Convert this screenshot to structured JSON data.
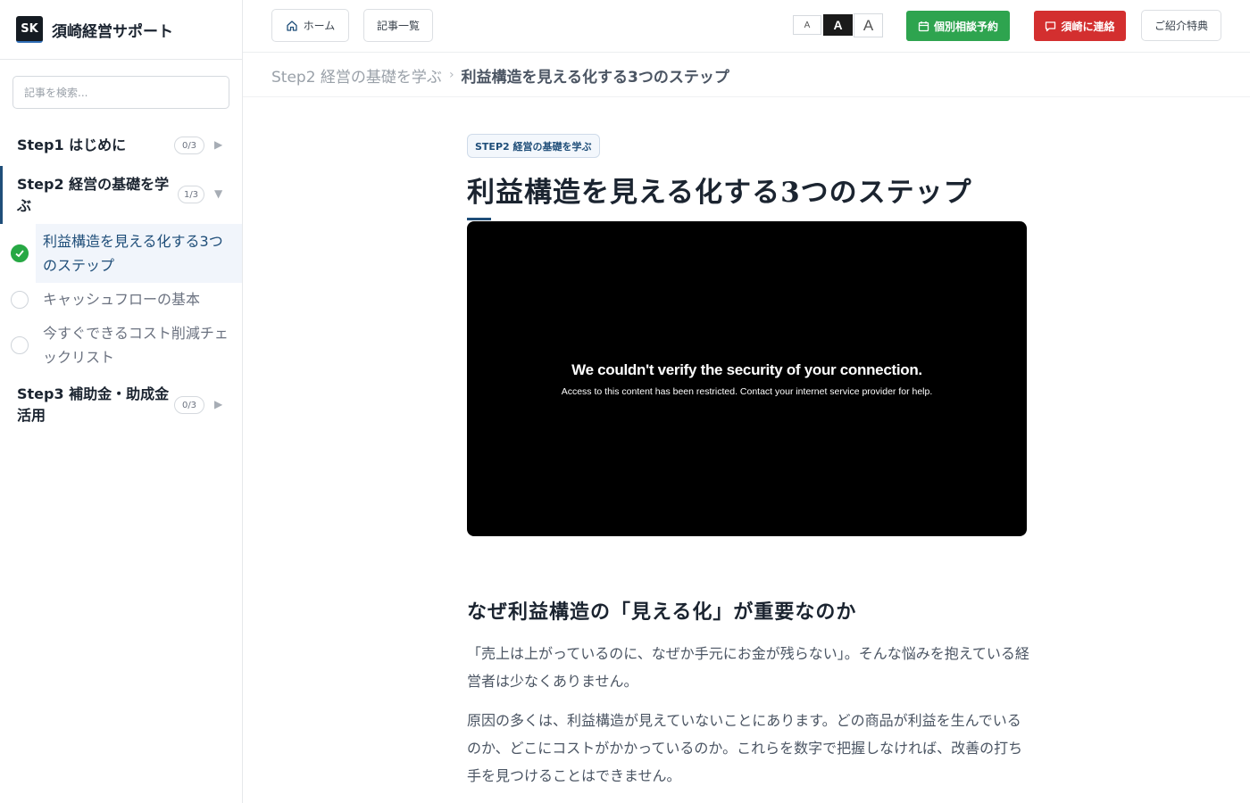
{
  "brand": {
    "logo": "SK",
    "name": "須崎経営サポート"
  },
  "search": {
    "placeholder": "記事を検索..."
  },
  "sidebar": {
    "steps": [
      {
        "title": "Step1 はじめに",
        "progress": "0/3",
        "expanded": false
      },
      {
        "title": "Step2 経営の基礎を学ぶ",
        "progress": "1/3",
        "expanded": true,
        "articles": [
          {
            "title": "利益構造を見える化する3つのステップ",
            "done": true,
            "active": true
          },
          {
            "title": "キャッシュフローの基本",
            "done": false,
            "active": false
          },
          {
            "title": "今すぐできるコスト削減チェックリスト",
            "done": false,
            "active": false
          }
        ]
      },
      {
        "title": "Step3 補助金・助成金活用",
        "progress": "0/3",
        "expanded": false
      }
    ]
  },
  "topbar": {
    "home": "ホーム",
    "articles": "記事一覧",
    "font_sizes": [
      "A",
      "A",
      "A"
    ],
    "consult": "個別相談予約",
    "contact": "須崎に連絡",
    "referral": "ご紹介特典"
  },
  "breadcrumb": {
    "parent": "Step2 経営の基礎を学ぶ",
    "separator": "›",
    "current": "利益構造を見える化する3つのステップ"
  },
  "main": {
    "tag": "STEP2 経営の基礎を学ぶ",
    "title": "利益構造を見える化する3つのステップ",
    "video": {
      "title": "We couldn't verify the security of your connection.",
      "subtitle": "Access to this content has been restricted. Contact your internet service provider for help."
    },
    "section_heading": "なぜ利益構造の「見える化」が重要なのか",
    "paragraphs": [
      "「売上は上がっているのに、なぜか手元にお金が残らない」。そんな悩みを抱えている経営者は少なくありません。",
      "原因の多くは、利益構造が見えていないことにあります。どの商品が利益を生んでいるのか、どこにコストがかかっているのか。これらを数字で把握しなければ、改善の打ち手を見つけることはできません。"
    ]
  },
  "colors": {
    "accent": "#1f4e79",
    "consult": "#2ea44f",
    "contact": "#d32f2f",
    "check": "#27a844"
  }
}
